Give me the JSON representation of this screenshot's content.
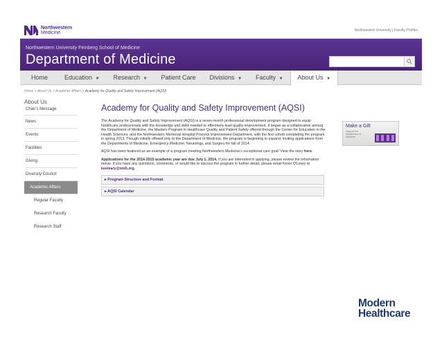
{
  "topbar": {
    "logo_line1": "Northwestern",
    "logo_line2": "Medicine",
    "util_links": "Northwestern University | Faculty Profiles"
  },
  "header": {
    "school_name": "Northwestern University Feinberg School of Medicine",
    "dept_title": "Department of Medicine",
    "search_placeholder": "",
    "search_icon": "search-icon"
  },
  "nav": {
    "items": [
      {
        "label": "Home",
        "caret": ""
      },
      {
        "label": "Education",
        "caret": "▼"
      },
      {
        "label": "Research",
        "caret": "▼"
      },
      {
        "label": "Patient Care",
        "caret": ""
      },
      {
        "label": "Divisions",
        "caret": "▼"
      },
      {
        "label": "Faculty",
        "caret": "▼"
      },
      {
        "label": "About Us",
        "caret": "▼"
      }
    ],
    "active_index": 6
  },
  "breadcrumb": {
    "path": "Home > About Us > Academic Affairs > ",
    "current": "Academy for Quality and Safety Improvement (AQSI)"
  },
  "sidebar": {
    "heading": "About Us",
    "items": [
      "Chair's Message",
      "News",
      "Events",
      "Facilities",
      "Giving",
      "Diversity Council",
      "Academic Affairs",
      "Regular Faculty",
      "Research Faculty",
      "Research Staff"
    ],
    "active": "Academic Affairs"
  },
  "main": {
    "title": "Academy for Quality and Safety Improvement (AQSI)",
    "para1": "The Academy for Quality and Safety Improvement (AQSI) is a seven-month professional development program designed to equip healthcare professionals with the knowledge and skills needed to effectively lead quality improvement.  It began as a collaboration among the Department of Medicine, the Masters Program in Healthcare Quality and Patient Safety offered through the Center for Education in the Health Sciences, and the Northwestern Memorial Hospital Process Improvement Department, with the first cohort completing the program in spring 2013. Though initially offered only to the Department of Medicine, the program is beginning to expand, inviting applications from the Departments of Medicine, Emergency Medicine, Neurology, and Surgery for fall of 2014.",
    "para2_text": "AQSI has been featured as an example of a program meeting Northwestern Medicine's exceptional care goal!  View the story ",
    "para2_link": "here",
    "para2_end": ".",
    "para3_bold": "Applications for the 2014-2015 academic year are due July 1, 2014.",
    "para3_text": "  If you are interested in applying, please review the information below. If you have any questions, comments, or would like to discuss the program in further detail, please email Kevin O'Leary at ",
    "para3_email": "keoleary@nmh.org",
    "para3_end": ".",
    "accordions": [
      "Program Structure and Format",
      "AQSI Calendar"
    ]
  },
  "gift": {
    "title": "Make a Gift",
    "subtitle": "Support the Department of Medicine"
  },
  "corner_logo": {
    "line1": "Modern",
    "line2": "Healthcare"
  },
  "colors": {
    "brand_purple": "#4e2a84",
    "header_purple": "#5b3592",
    "nav_gray": "#e6e6e6",
    "sidebar_active": "#8a8a8a",
    "mh_blue": "#1f3b6d"
  }
}
